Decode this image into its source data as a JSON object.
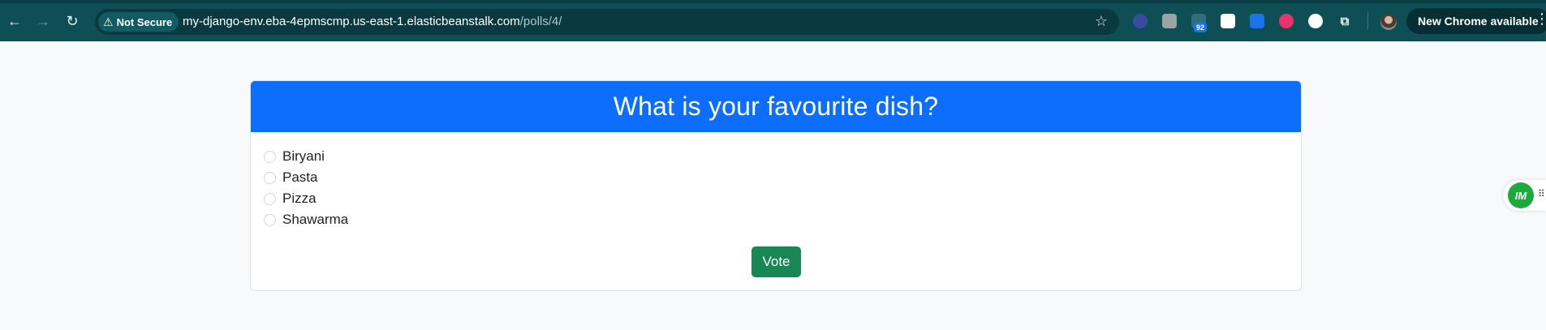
{
  "browser": {
    "security_label": "Not Secure",
    "url_host": "my-django-env.eba-4epmscmp.us-east-1.elasticbeanstalk.com",
    "url_path": "/polls/4/",
    "extension_badge": "92",
    "update_label": "New Chrome available",
    "icons": {
      "back": "←",
      "forward": "→",
      "reload": "↻",
      "warning": "⚠",
      "star": "☆",
      "puzzle": "⧉",
      "kebab": "⋮"
    }
  },
  "poll": {
    "question": "What is your favourite dish?",
    "choices": [
      "Biryani",
      "Pasta",
      "Pizza",
      "Shawarma"
    ],
    "vote_label": "Vote"
  },
  "widget": {
    "logo_text": "IM"
  },
  "colors": {
    "header_blue": "#0d6efd",
    "vote_green": "#198754",
    "chrome_teal": "#0e4e55"
  }
}
